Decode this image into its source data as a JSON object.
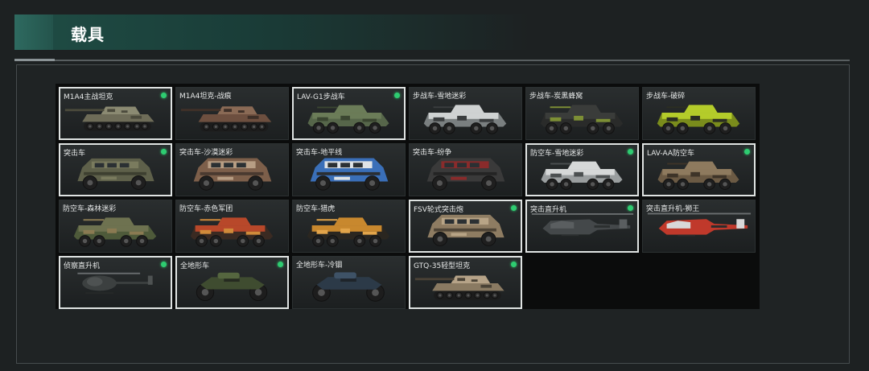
{
  "header": {
    "title": "载具"
  },
  "vehicles": [
    {
      "label": "M1A4主战坦克",
      "owned": true,
      "kind": "tank",
      "colors": [
        "#8b8a72",
        "#6e6c58",
        "#4b4a3c"
      ]
    },
    {
      "label": "M1A4坦克-战痕",
      "owned": false,
      "kind": "tank",
      "colors": [
        "#8a6a55",
        "#6d4f3f",
        "#3f3028"
      ]
    },
    {
      "label": "LAV-G1步战车",
      "owned": true,
      "kind": "ifv",
      "colors": [
        "#6b7c58",
        "#56664a",
        "#3b4631"
      ]
    },
    {
      "label": "步战车-雪地迷彩",
      "owned": false,
      "kind": "ifv",
      "colors": [
        "#cfd2d2",
        "#7a7f80",
        "#3a3d3e"
      ]
    },
    {
      "label": "步战车-炭黑蜂窝",
      "owned": false,
      "kind": "ifv",
      "colors": [
        "#3a3c3a",
        "#2a2b2a",
        "#7d8f35"
      ]
    },
    {
      "label": "步战车-破碎",
      "owned": false,
      "kind": "ifv",
      "colors": [
        "#b4cc2a",
        "#7a8c1c",
        "#2b2e22"
      ]
    },
    {
      "label": "突击车",
      "owned": true,
      "kind": "mrap",
      "colors": [
        "#7a7b5e",
        "#5e604a",
        "#3d3f30"
      ]
    },
    {
      "label": "突击车-沙漠迷彩",
      "owned": false,
      "kind": "mrap",
      "colors": [
        "#b89e84",
        "#7d5f4a",
        "#4a3a30"
      ]
    },
    {
      "label": "突击车-地平线",
      "owned": false,
      "kind": "mrap",
      "colors": [
        "#dfe3e6",
        "#3a6fb8",
        "#2a2e33"
      ]
    },
    {
      "label": "突击车-纷争",
      "owned": false,
      "kind": "mrap",
      "colors": [
        "#8a2b2b",
        "#3a3a3a",
        "#242424"
      ]
    },
    {
      "label": "防空车-雪地迷彩",
      "owned": true,
      "kind": "ifv",
      "colors": [
        "#d6d8d8",
        "#9a9e9f",
        "#4c5051"
      ]
    },
    {
      "label": "LAV-AA防空车",
      "owned": true,
      "kind": "ifv",
      "colors": [
        "#8e7a5e",
        "#6b5a44",
        "#3e3428"
      ]
    },
    {
      "label": "防空车-森林迷彩",
      "owned": false,
      "kind": "ifv",
      "colors": [
        "#6e7250",
        "#4e5a3a",
        "#8a7a52"
      ]
    },
    {
      "label": "防空车-赤色军团",
      "owned": false,
      "kind": "ifv",
      "colors": [
        "#b8482a",
        "#3a2a22",
        "#d08a3a"
      ]
    },
    {
      "label": "防空车-猎虎",
      "owned": false,
      "kind": "ifv",
      "colors": [
        "#c8882e",
        "#2a2620",
        "#e2a44a"
      ]
    },
    {
      "label": "FSV轮式突击炮",
      "owned": true,
      "kind": "mrap",
      "colors": [
        "#b8a486",
        "#8e7c62",
        "#4e4436"
      ]
    },
    {
      "label": "突击直升机",
      "owned": true,
      "kind": "heli",
      "colors": [
        "#5a5e60",
        "#44484a",
        "#2c2f30"
      ]
    },
    {
      "label": "突击直升机-狮王",
      "owned": false,
      "kind": "heli",
      "colors": [
        "#d8d8d8",
        "#c0392b",
        "#2c2c2c"
      ]
    },
    {
      "label": "侦察直升机",
      "owned": true,
      "kind": "littlebird",
      "colors": [
        "#4e5252",
        "#3c4040",
        "#262828"
      ]
    },
    {
      "label": "全地形车",
      "owned": true,
      "kind": "atv",
      "colors": [
        "#55663f",
        "#3f4c30",
        "#252a20"
      ]
    },
    {
      "label": "全地形车-冷锢",
      "owned": false,
      "kind": "atv",
      "colors": [
        "#3e5266",
        "#2c3a48",
        "#1e242a"
      ]
    },
    {
      "label": "GTQ-35轻型坦克",
      "owned": true,
      "kind": "lighttank",
      "colors": [
        "#b6a388",
        "#8a7a62",
        "#4a4236"
      ]
    }
  ]
}
